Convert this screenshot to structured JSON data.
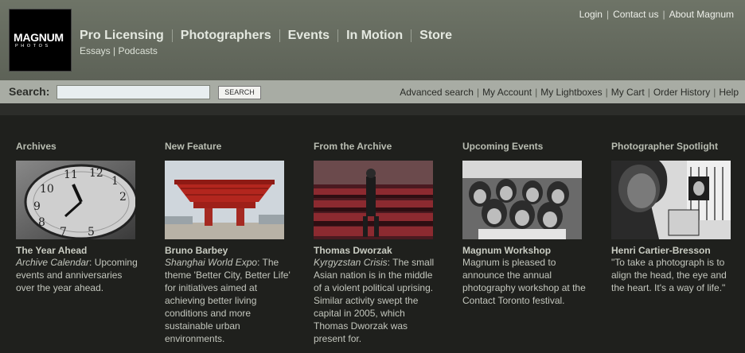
{
  "logo": {
    "line1": "MAGNUM",
    "line2": "PHOTOS"
  },
  "nav": {
    "items": [
      "Pro Licensing",
      "Photographers",
      "Events",
      "In Motion",
      "Store"
    ],
    "sub": [
      "Essays",
      "Podcasts"
    ]
  },
  "toplinks": [
    "Login",
    "Contact us",
    "About Magnum"
  ],
  "search": {
    "label": "Search:",
    "value": "",
    "button": "SEARCH"
  },
  "account_links": [
    "Advanced search",
    "My Account",
    "My Lightboxes",
    "My Cart",
    "Order History",
    "Help"
  ],
  "columns": [
    {
      "section": "Archives",
      "title": "The Year Ahead",
      "lead": "Archive Calendar",
      "body": ": Upcoming events and anniversaries over the year ahead.",
      "image": "clock-photo"
    },
    {
      "section": "New Feature",
      "title": "Bruno Barbey",
      "lead": "Shanghai World Expo",
      "body": ": The theme 'Better City, Better Life' for initiatives aimed at achieving better living conditions and more sustainable urban environments.",
      "image": "expo-pavilion-photo"
    },
    {
      "section": "From the Archive",
      "title": "Thomas Dworzak",
      "lead": "Kyrgyzstan Crisis",
      "body": ": The small Asian nation is in the middle of a violent political uprising. Similar activity swept the capital in 2005, which Thomas Dworzak was present for.",
      "image": "parliament-hall-photo"
    },
    {
      "section": "Upcoming Events",
      "title": "Magnum Workshop",
      "lead": "",
      "body": "Magnum is pleased to announce the annual photography workshop at the Contact Toronto festival.",
      "image": "classroom-photo"
    },
    {
      "section": "Photographer Spotlight",
      "title": "Henri Cartier-Bresson",
      "lead": "",
      "body": "\"To take a photograph is to align the head, the eye and the heart. It's a way of life.\"",
      "image": "portrait-photo"
    }
  ]
}
